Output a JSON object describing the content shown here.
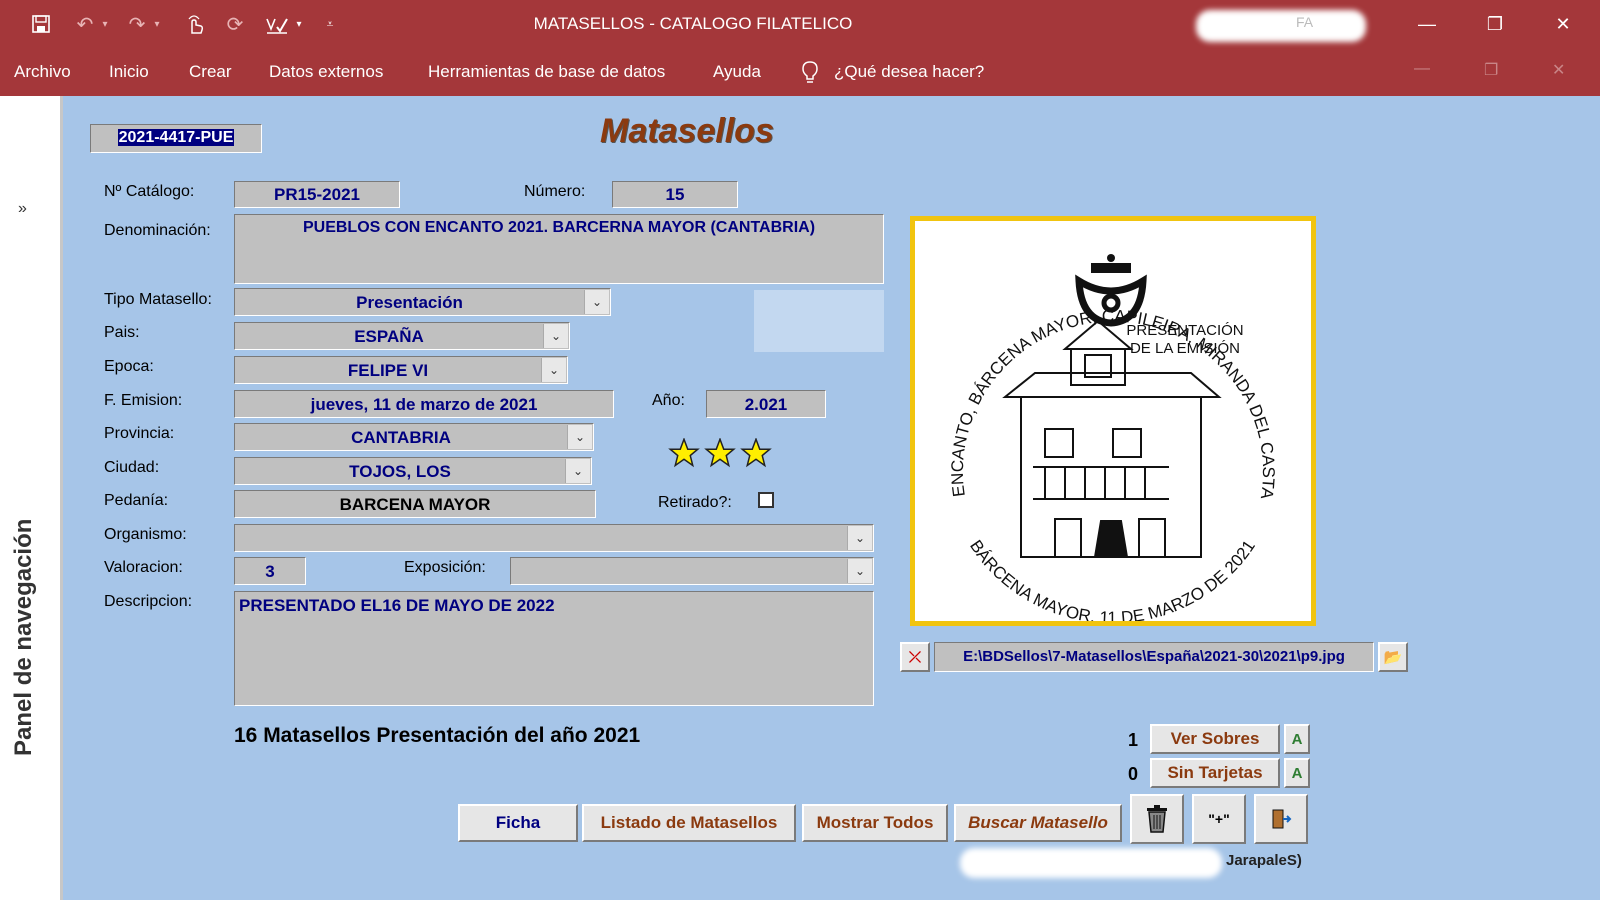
{
  "window": {
    "title": "MATASELLOS  -  CATALOGO FILATELICO",
    "minimize": "—",
    "restore": "❐",
    "close": "✕",
    "user_fragment": "FA"
  },
  "menu": {
    "items": [
      "Archivo",
      "Inicio",
      "Crear",
      "Datos externos",
      "Herramientas de base de datos",
      "Ayuda"
    ],
    "tell_me": "¿Qué desea hacer?"
  },
  "nav": {
    "label": "Panel de navegación",
    "chevron": "»"
  },
  "form": {
    "record_id": "2021-4417-PUE",
    "title": "Matasellos",
    "labels": {
      "catalogo": "Nº Catálogo:",
      "numero": "Número:",
      "denominacion": "Denominación:",
      "tipo": "Tipo Matasello:",
      "pais": "Pais:",
      "epoca": "Epoca:",
      "emision": "F. Emision:",
      "anio": "Año:",
      "provincia": "Provincia:",
      "ciudad": "Ciudad:",
      "pedania": "Pedanía:",
      "retirado": "Retirado?:",
      "organismo": "Organismo:",
      "valoracion": "Valoracion:",
      "exposicion": "Exposición:",
      "descripcion": "Descripcion:"
    },
    "values": {
      "catalogo": "PR15-2021",
      "numero": "15",
      "denominacion": "PUEBLOS CON ENCANTO 2021. BARCERNA MAYOR (CANTABRIA)",
      "tipo": "Presentación",
      "pais": "ESPAÑA",
      "epoca": "FELIPE VI",
      "emision": "jueves, 11 de marzo de 2021",
      "anio": "2.021",
      "provincia": "CANTABRIA",
      "ciudad": "TOJOS, LOS",
      "pedania": "BARCENA MAYOR",
      "organismo": "",
      "valoracion": "3",
      "exposicion": "",
      "descripcion": "PRESENTADO EL16 DE MAYO DE 2022"
    },
    "rating_stars": 3,
    "retirado_checked": false,
    "summary": "16 Matasellos Presentación del año 2021",
    "image_path": "E:\\BDSellos\\7-Matasellos\\España\\2021-30\\2021\\p9.jpg",
    "sobres_count": "1",
    "tarjetas_count": "0",
    "buttons": {
      "ver_sobres": "Ver Sobres",
      "sin_tarjetas": "Sin Tarjetas",
      "a": "A",
      "ficha": "Ficha",
      "listado": "Listado de Matasellos",
      "mostrar": "Mostrar Todos",
      "buscar": "Buscar Matasello",
      "add": "\"+\""
    },
    "footer_fragment": "JarapaleS)"
  },
  "stamp": {
    "arc_top": "PUEBLOS CON ENCANTO, BÁRCENA MAYOR, CAPILEIRA, MIRANDA DEL CASTAÑAR Y TORAZU",
    "arc_bottom": "BÁRCENA MAYOR, 11 DE MARZO DE 2021",
    "center_line1": "PRESENTACIÓN",
    "center_line2": "DE LA EMISIÓN"
  },
  "colors": {
    "titlebar": "#a4373a",
    "form_bg": "#a6c5e8",
    "field_text": "#000080",
    "title_brown": "#8b3a0f",
    "stamp_border": "#f1c40f",
    "star": "#ffee00"
  }
}
